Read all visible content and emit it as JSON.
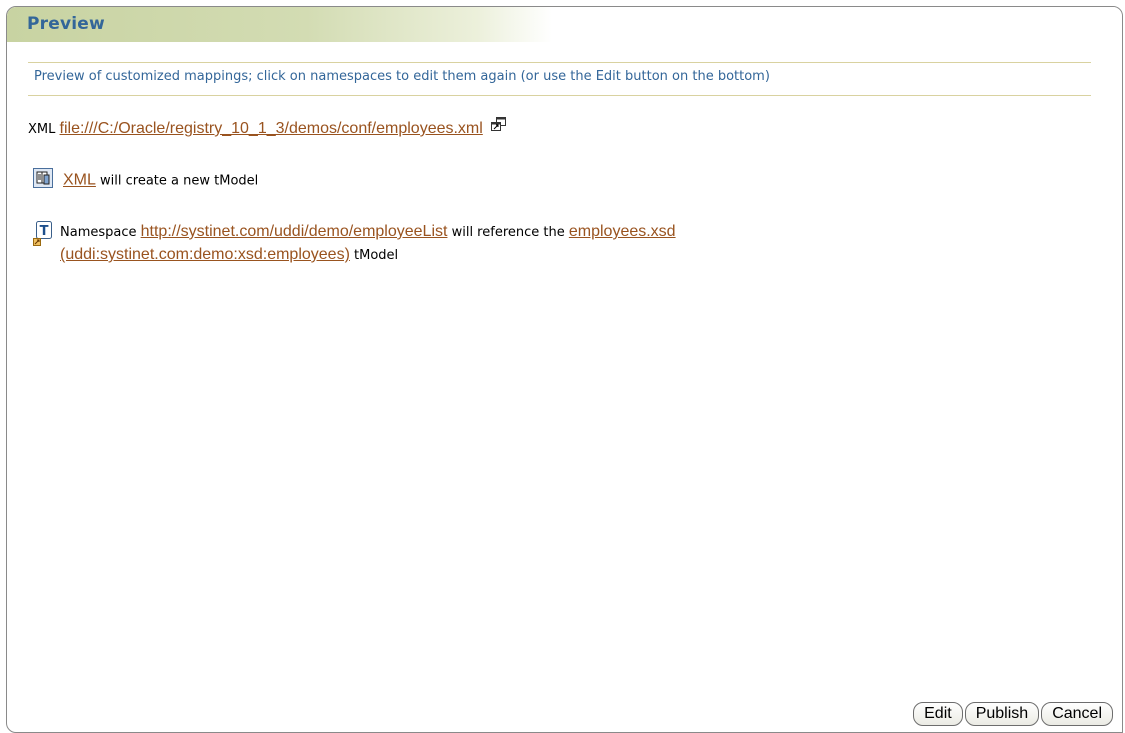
{
  "panel": {
    "title": "Preview",
    "instruction": "Preview of customized mappings; click on namespaces to edit them again (or use the Edit button on the bottom)"
  },
  "source": {
    "label": "XML",
    "link": "file:///C:/Oracle/registry_10_1_3/demos/conf/employees.xml",
    "link_icon": "external-window-icon"
  },
  "xml_row": {
    "icon": "book-icon",
    "link": "XML",
    "text": " will create a new tModel"
  },
  "namespace_row": {
    "icon": "tmodel-icon",
    "prefix": "Namespace ",
    "namespace_link": "http://systinet.com/uddi/demo/employeeList",
    "middle": " will reference the ",
    "target_link_line1": "employees.xsd",
    "target_link_line2": "(uddi:systinet.com:demo:xsd:employees)",
    "suffix": " tModel"
  },
  "buttons": {
    "edit": "Edit",
    "publish": "Publish",
    "cancel": "Cancel"
  },
  "colors": {
    "title": "#336699",
    "instruction": "#336699",
    "link": "#99531f",
    "header_gradient_start": "#c8d3a2"
  }
}
